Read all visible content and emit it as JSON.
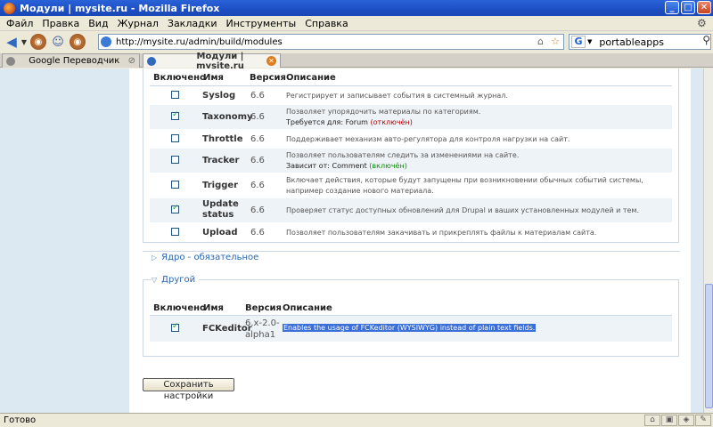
{
  "window": {
    "title": "Модули | mysite.ru - Mozilla Firefox",
    "minimize": "_",
    "maximize": "□",
    "close": "✕"
  },
  "menu": [
    "Файл",
    "Правка",
    "Вид",
    "Журнал",
    "Закладки",
    "Инструменты",
    "Справка"
  ],
  "nav": {
    "url": "http://mysite.ru/admin/build/modules",
    "search_value": "portableapps"
  },
  "tabs": [
    {
      "label": "Google Переводчик"
    },
    {
      "label": "Модули | mysite.ru"
    }
  ],
  "table_headers": {
    "enabled": "Включено",
    "name": "Имя",
    "version": "Версия",
    "description": "Описание"
  },
  "modules": [
    {
      "name": "Syslog",
      "version": "6.6",
      "checked": false,
      "desc": "Регистрирует и записывает события в системный журнал."
    },
    {
      "name": "Taxonomy",
      "version": "6.6",
      "checked": true,
      "desc": "Позволяет упорядочить материалы по категориям.",
      "sub_label": "Требуется для:",
      "sub_value": "Forum",
      "sub_status": "(отключён)"
    },
    {
      "name": "Throttle",
      "version": "6.6",
      "checked": false,
      "desc": "Поддерживает механизм авто-регулятора для контроля нагрузки на сайт."
    },
    {
      "name": "Tracker",
      "version": "6.6",
      "checked": false,
      "desc": "Позволяет пользователям следить за изменениями на сайте.",
      "sub_label": "Зависит от:",
      "sub_value": "Comment",
      "sub_status": "(включён)"
    },
    {
      "name": "Trigger",
      "version": "6.6",
      "checked": false,
      "desc": "Включает действия, которые будут запущены при возникновении обычных событий системы, например создание нового материала."
    },
    {
      "name_line1": "Update",
      "name_line2": "status",
      "version": "6.6",
      "checked": true,
      "desc": "Проверяет статус доступных обновлений для Drupal и ваших установленных модулей и тем."
    },
    {
      "name": "Upload",
      "version": "6.6",
      "checked": false,
      "desc": "Позволяет пользователям закачивать и прикреплять файлы к материалам сайта."
    }
  ],
  "sections": {
    "core": "Ядро - обязательное",
    "other": "Другой"
  },
  "other_modules": [
    {
      "name": "FCKeditor",
      "version_line1": "6.x-2.0-",
      "version_line2": "alpha1",
      "checked": true,
      "desc": "Enables the usage of FCKeditor (WYSIWYG) instead of plain text fields."
    }
  ],
  "save_button": "Сохранить настройки",
  "status": "Готово",
  "colors": {
    "titlebar": "#1d4fc4",
    "link": "#2a66b2",
    "row_alt": "#eef3f7",
    "page_bg": "#dde9f2",
    "selection": "#3a6ed8"
  }
}
